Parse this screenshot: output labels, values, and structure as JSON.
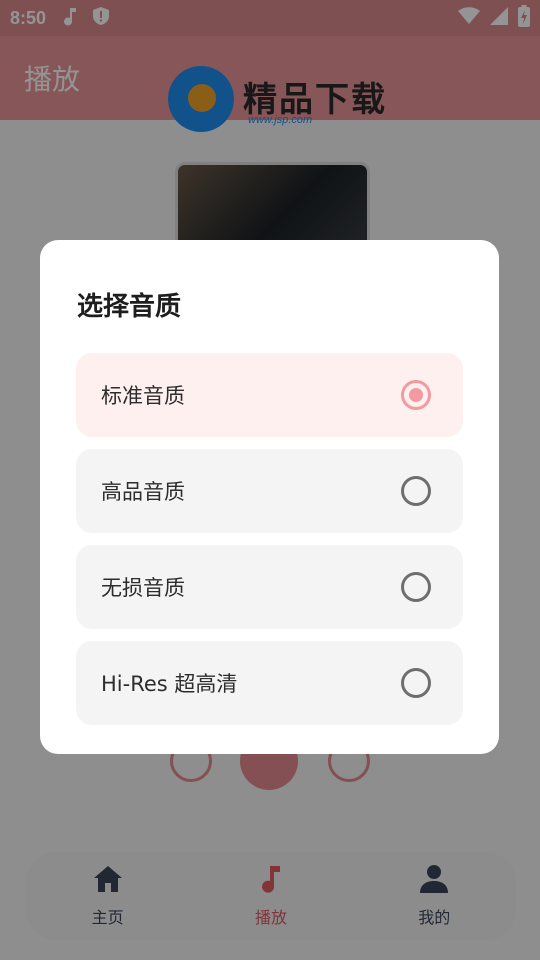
{
  "status": {
    "time": "8:50",
    "icons_left": [
      "music-note-icon",
      "shield-alert-icon"
    ],
    "icons_right": [
      "wifi-icon",
      "signal-icon",
      "battery-charging-icon"
    ]
  },
  "appbar": {
    "title": "播放"
  },
  "watermark": {
    "text": "精品下载",
    "url": "www.jsp.com"
  },
  "dialog": {
    "title": "选择音质",
    "options": [
      {
        "label": "标准音质",
        "selected": true
      },
      {
        "label": "高品音质",
        "selected": false
      },
      {
        "label": "无损音质",
        "selected": false
      },
      {
        "label": "Hi-Res 超高清",
        "selected": false
      }
    ]
  },
  "nav": {
    "items": [
      {
        "label": "主页",
        "icon": "home-icon"
      },
      {
        "label": "播放",
        "icon": "music-note-icon",
        "active": true
      },
      {
        "label": "我的",
        "icon": "person-icon"
      }
    ]
  },
  "colors": {
    "accent": "#f39aa0",
    "appbar": "#e89599",
    "nav_active": "#e05a63",
    "nav_inactive": "#3a4659"
  }
}
